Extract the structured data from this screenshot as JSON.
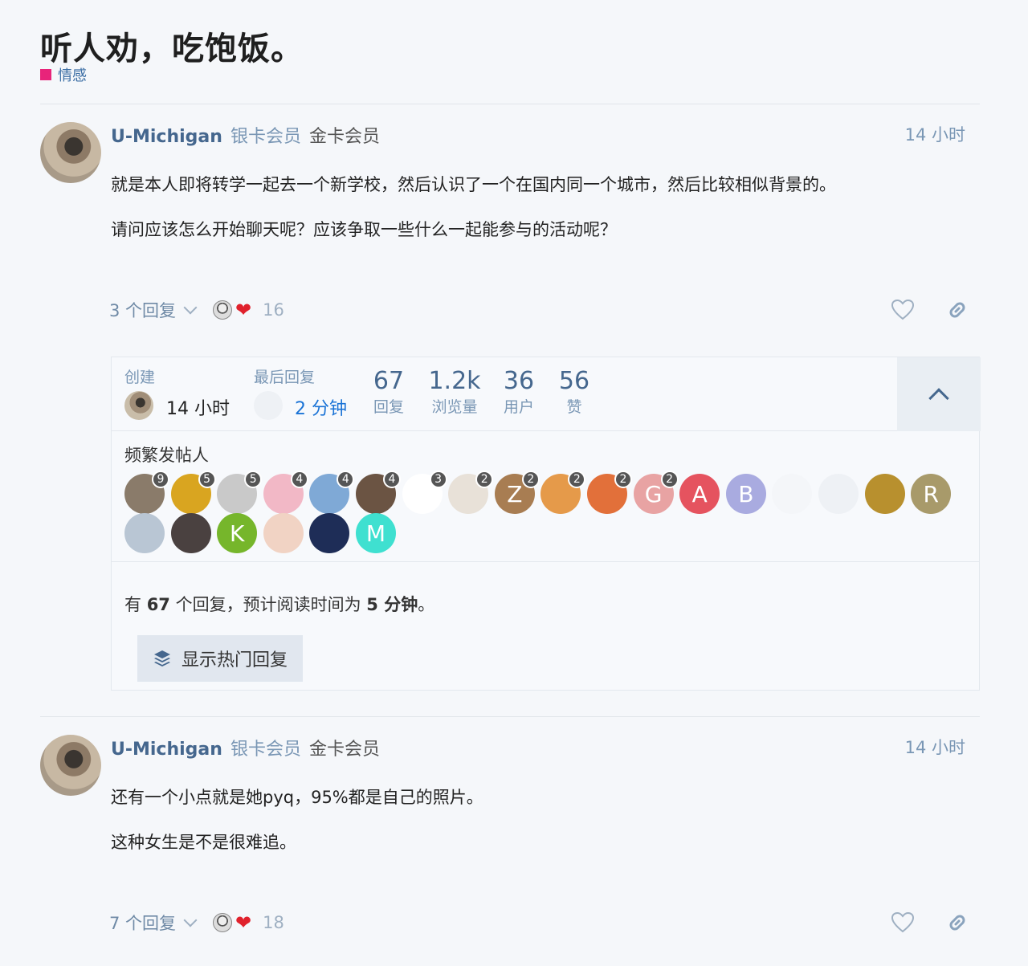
{
  "topic": {
    "title": "听人劝，吃饱饭。",
    "category": "情感",
    "category_color": "#e8247a"
  },
  "posts": [
    {
      "username": "U-Michigan",
      "badge1": "银卡会员",
      "badge2": "金卡会员",
      "time": "14 小时",
      "paragraphs": [
        "就是本人即将转学一起去一个新学校，然后认识了一个在国内同一个城市，然后比较相似背景的。",
        "请问应该怎么开始聊天呢？应该争取一些什么一起能参与的活动呢？"
      ],
      "replies_label": "3 个回复",
      "reaction_count": "16"
    },
    {
      "username": "U-Michigan",
      "badge1": "银卡会员",
      "badge2": "金卡会员",
      "time": "14 小时",
      "paragraphs": [
        "还有一个小点就是她pyq，95%都是自己的照片。",
        "这种女生是不是很难追。"
      ],
      "replies_label": "7 个回复",
      "reaction_count": "18"
    }
  ],
  "topic_map": {
    "created_label": "创建",
    "created_time": "14 小时",
    "last_reply_label": "最后回复",
    "last_reply_time": "2 分钟",
    "stats": [
      {
        "num": "67",
        "label": "回复"
      },
      {
        "num": "1.2k",
        "label": "浏览量"
      },
      {
        "num": "36",
        "label": "用户"
      },
      {
        "num": "56",
        "label": "赞"
      }
    ],
    "frequent_posters_label": "频繁发帖人",
    "posters": [
      {
        "letter": "",
        "count": "9",
        "color": "#8a7b6a"
      },
      {
        "letter": "",
        "count": "5",
        "color": "#d9a520"
      },
      {
        "letter": "",
        "count": "5",
        "color": "#c9c9c9"
      },
      {
        "letter": "",
        "count": "4",
        "color": "#f2b8c6"
      },
      {
        "letter": "",
        "count": "4",
        "color": "#7fa9d6"
      },
      {
        "letter": "",
        "count": "4",
        "color": "#6b5443"
      },
      {
        "letter": "",
        "count": "3",
        "color": "#ffffff"
      },
      {
        "letter": "",
        "count": "2",
        "color": "#e8e1d8"
      },
      {
        "letter": "Z",
        "count": "2",
        "color": "#a87d52"
      },
      {
        "letter": "",
        "count": "2",
        "color": "#e59a4a"
      },
      {
        "letter": "",
        "count": "2",
        "color": "#e2703a"
      },
      {
        "letter": "G",
        "count": "2",
        "color": "#e8a3a3"
      },
      {
        "letter": "A",
        "count": "",
        "color": "#e5535f"
      },
      {
        "letter": "B",
        "count": "",
        "color": "#a9abe0"
      },
      {
        "letter": "",
        "count": "",
        "color": "#f4f6f9"
      },
      {
        "letter": "",
        "count": "",
        "color": "#eef1f5"
      },
      {
        "letter": "",
        "count": "",
        "color": "#b8902e"
      },
      {
        "letter": "R",
        "count": "",
        "color": "#a89a6a"
      },
      {
        "letter": "",
        "count": "",
        "color": "#b9c6d4"
      },
      {
        "letter": "",
        "count": "",
        "color": "#4a4140"
      },
      {
        "letter": "K",
        "count": "",
        "color": "#76b62b"
      },
      {
        "letter": "",
        "count": "",
        "color": "#f1d3c4"
      },
      {
        "letter": "",
        "count": "",
        "color": "#1e2d57"
      },
      {
        "letter": "M",
        "count": "",
        "color": "#3fe0d0"
      }
    ],
    "summary_prefix": "有 ",
    "summary_replies": "67",
    "summary_mid": " 个回复，预计阅读时间为 ",
    "summary_time": "5 分钟",
    "summary_suffix": "。",
    "hot_button_label": "显示热门回复"
  }
}
